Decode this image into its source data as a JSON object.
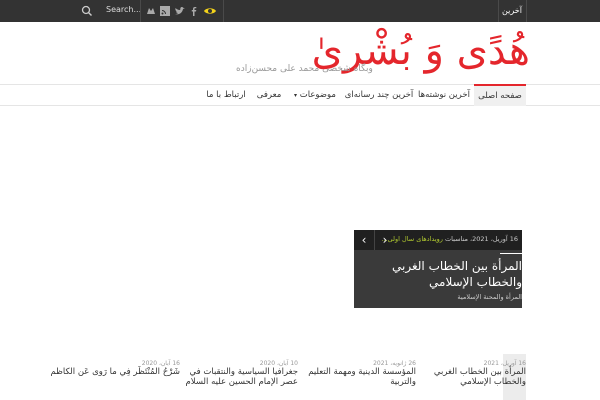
{
  "topbar": {
    "search_label": "Search...",
    "latest_label": "آخرین",
    "icons": [
      "search-icon",
      "social-icon-1",
      "feed-icon",
      "mail-icon",
      "twitter-icon",
      "facebook-icon",
      "eye-icon"
    ]
  },
  "header": {
    "logo_text": "هُدًى وَ بُشْرىٰ",
    "tagline": "وبگاه شخصی محمد علی محسن‌زاده"
  },
  "nav": {
    "items": [
      {
        "label": "صفحه اصلی"
      },
      {
        "label": "آخرین نوشته‌ها"
      },
      {
        "label": "آخرین چند رسانه‌ای"
      },
      {
        "label": "موضوعات"
      },
      {
        "label": "معرفی"
      },
      {
        "label": "ارتباط با ما"
      }
    ]
  },
  "slider": {
    "prev_label": "‹",
    "next_label": "›",
    "date": "16 آوریل، 2021",
    "meta_sep": "، مناسبات",
    "category_link": "رویدادهای سال اولی...",
    "title": "المرأة بين الخطاب الغربي والخطاب الإسلامي",
    "bottom_category": "المرأة والمحنة الإسلامية"
  },
  "posts": [
    {
      "date": "16 آوریل، 2021",
      "title_line1": "المرأة بين الخطاب الغربي",
      "title_line2": "والخطاب الإسلامي"
    },
    {
      "date": "26 ژانویه، 2021",
      "title_line1": "المؤسسة الدينية ومهمة التعليم",
      "title_line2": "والتربية"
    },
    {
      "date": "10 آبان، 2020",
      "title_line1": "جغرافيا السياسية والنتقبات في",
      "title_line2": "عصر الإمام الحسين عليه السلام"
    },
    {
      "date": "16 آبان، 2020",
      "title_line1": "شَرْحُ المُنْتَظَر فِي ما رَوى عَن الكاظم",
      "title_line2": ""
    }
  ],
  "colors": {
    "accent": "#e4262c",
    "topbar": "#333333",
    "slider_bg": "#3a3a3a",
    "slider_cat": "#b0c830"
  }
}
